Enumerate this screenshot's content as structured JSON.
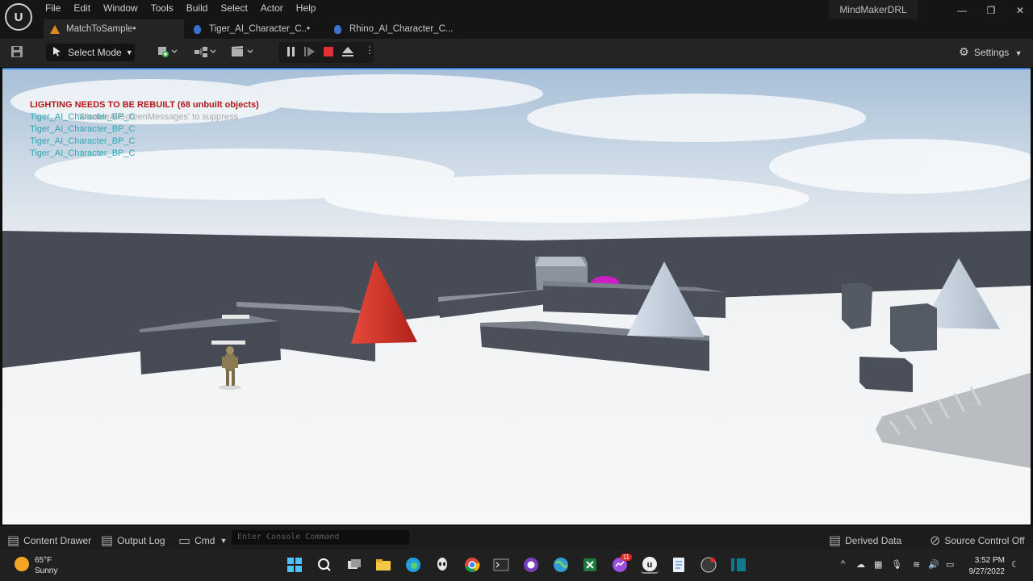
{
  "menu": [
    "File",
    "Edit",
    "Window",
    "Tools",
    "Build",
    "Select",
    "Actor",
    "Help"
  ],
  "project_name": "MindMakerDRL",
  "window_controls": {
    "minimize": "—",
    "restore": "❐",
    "close": "✕"
  },
  "tabs": [
    {
      "label": "MatchToSample•"
    },
    {
      "label": "Tiger_AI_Character_C..•"
    },
    {
      "label": "Rhino_AI_Character_C..."
    }
  ],
  "toolbar": {
    "select_mode": "Select Mode",
    "settings": "Settings"
  },
  "viewport": {
    "warning": "LIGHTING NEEDS TO BE REBUILT (68 unbuilt objects)",
    "hint": "'DisableAllScreenMessages' to suppress",
    "actors": [
      "Tiger_AI_Character_BP_C",
      "Tiger_AI_Character_BP_C",
      "Tiger_AI_Character_BP_C",
      "Tiger_AI_Character_BP_C"
    ]
  },
  "statusbar": {
    "content_drawer": "Content Drawer",
    "output_log": "Output Log",
    "cmd": "Cmd",
    "console_placeholder": "Enter Console Command",
    "derived_data": "Derived Data",
    "source_control": "Source Control Off"
  },
  "weather": {
    "temp": "65°F",
    "condition": "Sunny"
  },
  "clock": {
    "time": "3:52 PM",
    "date": "9/27/2022"
  },
  "taskbar_badge": "11",
  "colors": {
    "warning": "#b01818",
    "actor_text": "#2aa8b3",
    "accent": "#3a7bd5",
    "stop": "#e03030",
    "cone_red": "#d42a20",
    "sphere": "#d020c0"
  }
}
